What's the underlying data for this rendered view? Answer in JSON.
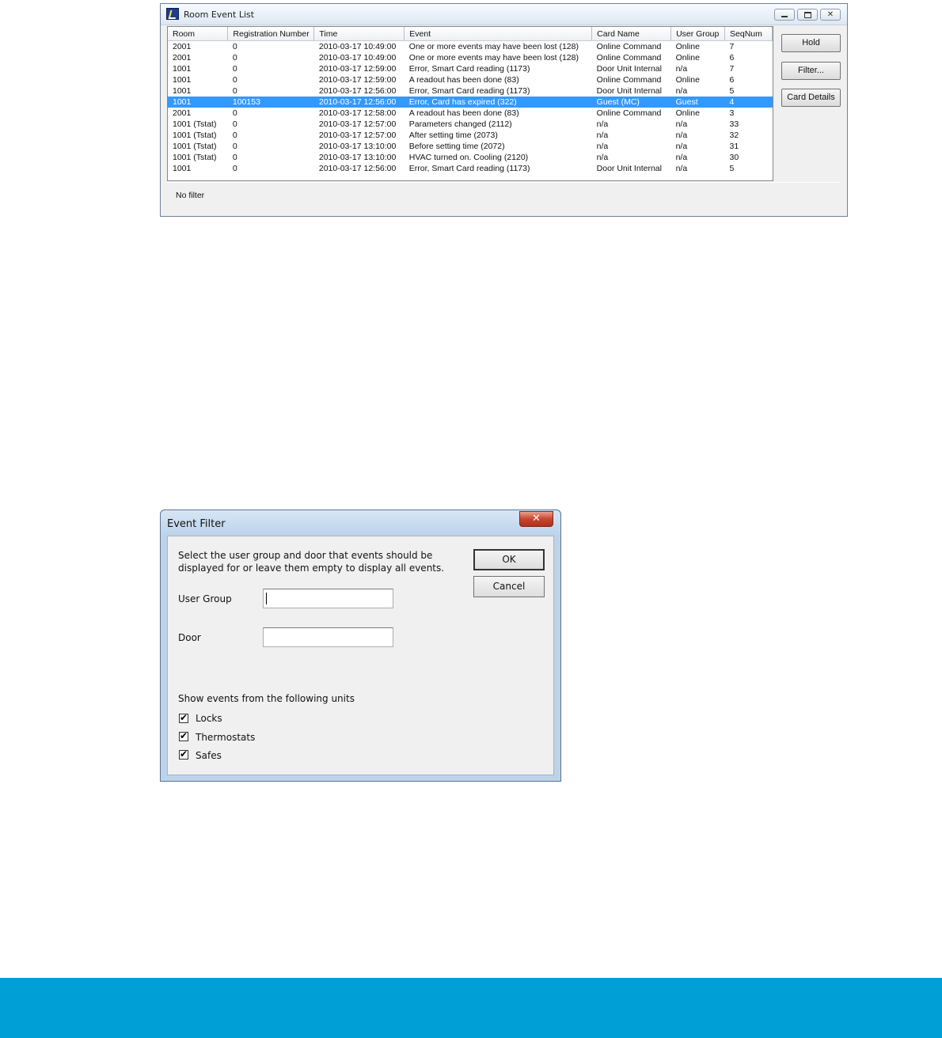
{
  "event_list_window": {
    "title": "Room Event List",
    "columns": [
      "Room",
      "Registration Number",
      "Time",
      "Event",
      "Card Name",
      "User Group",
      "SeqNum"
    ],
    "rows": [
      [
        "2001",
        "0",
        "2010-03-17 10:49:00",
        "One or more events may have been lost (128)",
        "Online Command",
        "Online",
        "7"
      ],
      [
        "2001",
        "0",
        "2010-03-17 10:49:00",
        "One or more events may have been lost (128)",
        "Online Command",
        "Online",
        "6"
      ],
      [
        "1001",
        "0",
        "2010-03-17 12:59:00",
        "Error, Smart Card reading (1173)",
        "Door Unit Internal",
        "n/a",
        "7"
      ],
      [
        "1001",
        "0",
        "2010-03-17 12:59:00",
        "A readout has been done (83)",
        "Online Command",
        "Online",
        "6"
      ],
      [
        "1001",
        "0",
        "2010-03-17 12:56:00",
        "Error, Smart Card reading (1173)",
        "Door Unit Internal",
        "n/a",
        "5"
      ],
      [
        "1001",
        "100153",
        "2010-03-17 12:56:00",
        "Error, Card has expired (322)",
        "Guest (MC)",
        "Guest",
        "4"
      ],
      [
        "2001",
        "0",
        "2010-03-17 12:58:00",
        "A readout has been done (83)",
        "Online Command",
        "Online",
        "3"
      ],
      [
        "1001 (Tstat)",
        "0",
        "2010-03-17 12:57:00",
        "Parameters changed (2112)",
        "n/a",
        "n/a",
        "33"
      ],
      [
        "1001 (Tstat)",
        "0",
        "2010-03-17 12:57:00",
        "After setting time (2073)",
        "n/a",
        "n/a",
        "32"
      ],
      [
        "1001 (Tstat)",
        "0",
        "2010-03-17 13:10:00",
        "Before setting time (2072)",
        "n/a",
        "n/a",
        "31"
      ],
      [
        "1001 (Tstat)",
        "0",
        "2010-03-17 13:10:00",
        "HVAC turned on. Cooling (2120)",
        "n/a",
        "n/a",
        "30"
      ],
      [
        "1001",
        "0",
        "2010-03-17 12:56:00",
        "Error, Smart Card reading (1173)",
        "Door Unit Internal",
        "n/a",
        "5"
      ]
    ],
    "selected_row": 5,
    "buttons": {
      "hold": "Hold",
      "filter": "Filter...",
      "card_details": "Card Details"
    },
    "status": "No filter"
  },
  "event_filter_dialog": {
    "title": "Event Filter",
    "close_glyph": "✕",
    "instructions_line1": "Select the user group and door that events should be",
    "instructions_line2": "displayed for or leave them empty to display all events.",
    "user_group_label": "User Group",
    "user_group_value": "",
    "door_label": "Door",
    "door_value": "",
    "ok": "OK",
    "cancel": "Cancel",
    "units_heading": "Show events from the following units",
    "units": [
      {
        "label": "Locks",
        "checked": true
      },
      {
        "label": "Thermostats",
        "checked": true
      },
      {
        "label": "Safes",
        "checked": true
      }
    ]
  },
  "colors": {
    "selection": "#3399ff",
    "footer_band": "#009fd6"
  }
}
